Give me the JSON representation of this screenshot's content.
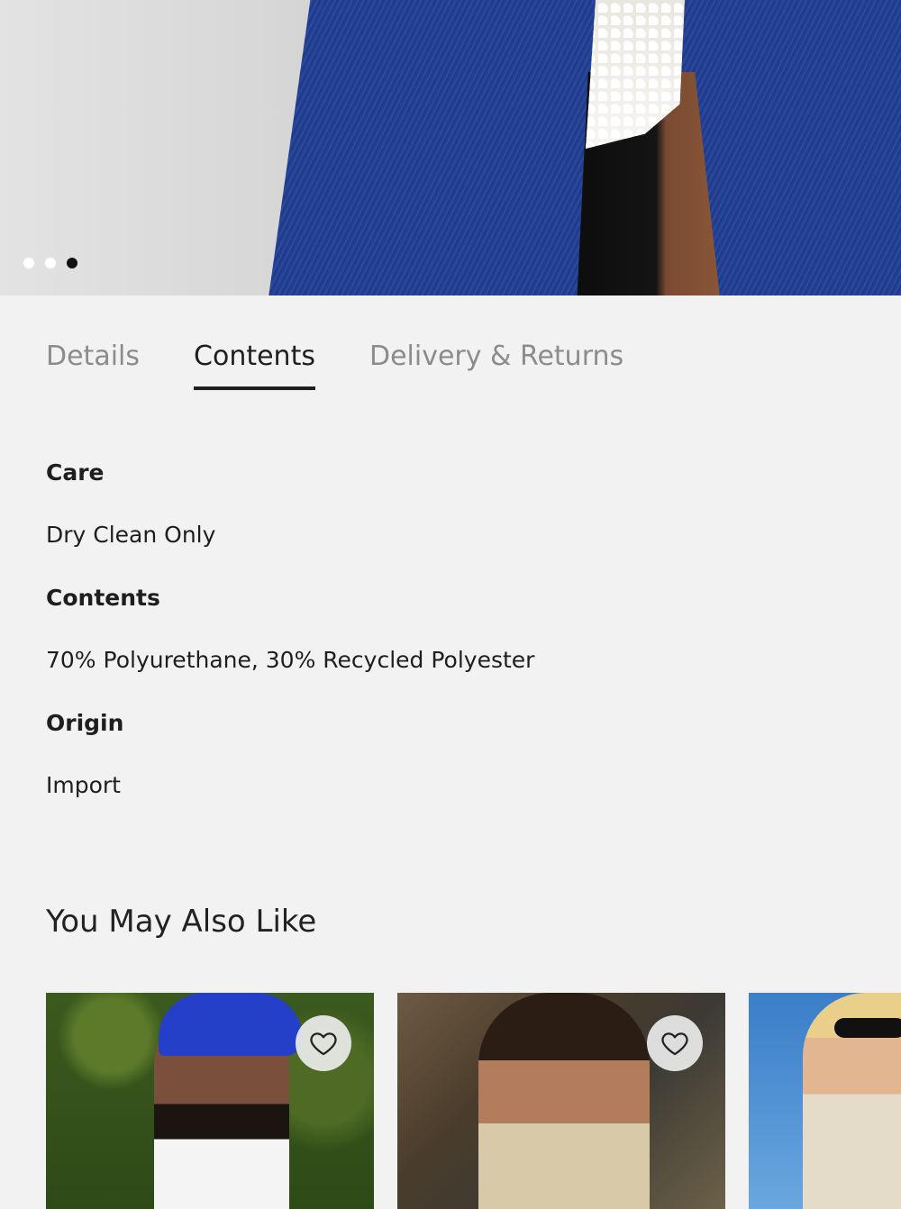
{
  "carousel": {
    "total": 3,
    "active_index": 2
  },
  "tabs": [
    {
      "label": "Details",
      "active": false
    },
    {
      "label": "Contents",
      "active": true
    },
    {
      "label": "Delivery & Returns",
      "active": false
    }
  ],
  "contents": {
    "care_label": "Care",
    "care_value": "Dry Clean Only",
    "contents_label": "Contents",
    "contents_value": "70% Polyurethane, 30% Recycled Polyester",
    "origin_label": "Origin",
    "origin_value": "Import"
  },
  "recommendations": {
    "title": "You May Also Like",
    "items": [
      {
        "icon": "heart-icon"
      },
      {
        "icon": "heart-icon"
      },
      {
        "icon": ""
      }
    ]
  }
}
